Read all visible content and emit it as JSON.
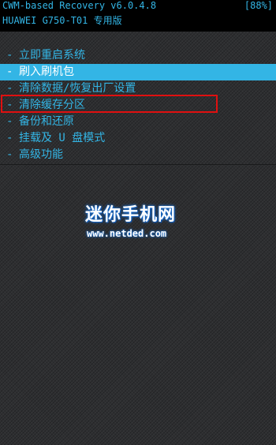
{
  "header": {
    "version_line": "CWM-based Recovery v6.0.4.8",
    "battery": "[88%]",
    "device_line": "HUAWEI G750-T01 专用版"
  },
  "menu": {
    "items": [
      {
        "dash": "-",
        "label": "立即重启系统"
      },
      {
        "dash": "-",
        "label": "刷入刷机包"
      },
      {
        "dash": "-",
        "label": "清除数据/恢复出厂设置"
      },
      {
        "dash": "-",
        "label": "清除缓存分区"
      },
      {
        "dash": "-",
        "label": "备份和还原"
      },
      {
        "dash": "-",
        "label": "挂载及 U 盘模式"
      },
      {
        "dash": "-",
        "label": "高级功能"
      }
    ],
    "selected_index": 1,
    "highlighted_index": 3
  },
  "watermark": {
    "title": "迷你手机网",
    "url": "www.netded.com"
  },
  "colors": {
    "accent": "#33b5e5",
    "highlight_box": "#e01010",
    "header_bg": "#000000"
  }
}
